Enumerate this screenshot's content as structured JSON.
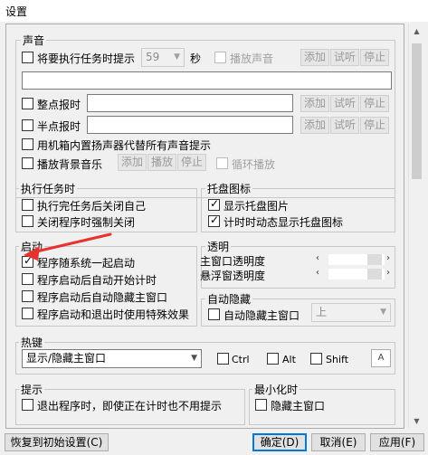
{
  "window": {
    "title": "设置"
  },
  "sound": {
    "title": "声音",
    "exec_tip": {
      "label": "将要执行任务时提示",
      "seconds_value": "59",
      "seconds_unit": "秒",
      "play_label": "播放声音"
    },
    "buttons": {
      "add": "添加",
      "preview": "试听",
      "stop": "停止"
    },
    "hour_chime": "整点报时",
    "half_chime": "半点报时",
    "beeper": "用机箱内置扬声器代替所有声音提示",
    "bg_music": "播放背景音乐",
    "bg_buttons": {
      "add": "添加",
      "play": "播放",
      "stop": "停止"
    },
    "loop": "循环播放"
  },
  "exec_task": {
    "title": "执行任务时",
    "close_after": "执行完任务后关闭自己",
    "force_close": "关闭程序时强制关闭"
  },
  "tray": {
    "title": "托盘图标",
    "show_icon": "显示托盘图片",
    "dynamic": "计时时动态显示托盘图标"
  },
  "startup": {
    "title": "启动",
    "items": [
      {
        "label": "程序随系统一起启动",
        "checked": true
      },
      {
        "label": "程序启动后自动开始计时",
        "checked": false
      },
      {
        "label": "程序启动后自动隐藏主窗口",
        "checked": false
      },
      {
        "label": "程序启动和退出时使用特殊效果",
        "checked": false
      }
    ]
  },
  "transparency": {
    "title": "透明",
    "main_label": "主窗口透明度",
    "float_label": "悬浮窗透明度"
  },
  "autohide": {
    "title": "自动隐藏",
    "label": "自动隐藏主窗口",
    "position_value": "上"
  },
  "hotkey": {
    "title": "热键",
    "action_value": "显示/隐藏主窗口",
    "ctrl": "Ctrl",
    "alt": "Alt",
    "shift": "Shift",
    "key_value": "A"
  },
  "tip": {
    "title": "提示",
    "exit_tip": "退出程序时，即使正在计时也不用提示"
  },
  "minimize": {
    "title": "最小化时",
    "hide_main": "隐藏主窗口"
  },
  "footer": {
    "reset": "恢复到初始设置(C)",
    "ok": "确定(D)",
    "cancel": "取消(E)",
    "apply": "应用(F)"
  },
  "colors": {
    "accent": "#0078d7",
    "annotation": "#e8322d"
  }
}
